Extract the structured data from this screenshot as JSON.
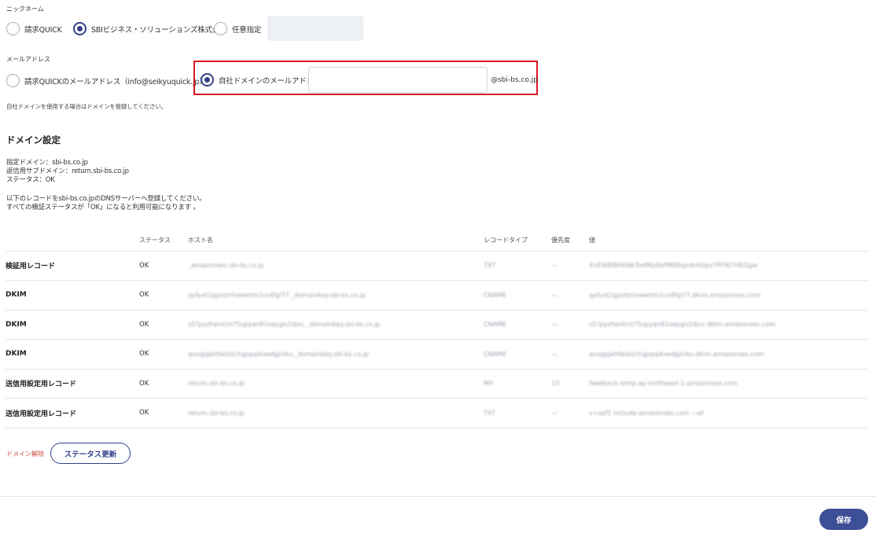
{
  "nickname": {
    "label": "ニックネーム",
    "options": [
      {
        "label": "請求QUICK",
        "checked": false
      },
      {
        "label": "SBIビジネス・ソリューションズ株式会社",
        "checked": true
      },
      {
        "label": "任意指定",
        "checked": false
      }
    ],
    "custom_value": ""
  },
  "email": {
    "label": "メールアドレス",
    "option_default": "請求QUICKのメールアドレス（info@seikyuquick.jp）",
    "option_custom": "自社ドメインのメールアドレス",
    "local_part_value": "",
    "domain_suffix": "@sbi-bs.co.jp",
    "note": "自社ドメインを使用する場合はドメインを登録してください。"
  },
  "domain": {
    "heading": "ドメイン設定",
    "info": [
      "指定ドメイン：sbi-bs.co.jp",
      "返信用サブドメイン：return.sbi-bs.co.jp",
      "ステータス：OK"
    ],
    "instructions": [
      "以下のレコードをsbi-bs.co.jpのDNSサーバーへ登録してください。",
      "すべての検証ステータスが「OK」になると利用可能になります 。"
    ]
  },
  "table": {
    "headers": [
      "",
      "ステータス",
      "ホスト名",
      "レコードタイプ",
      "優先度",
      "値"
    ],
    "rows": [
      {
        "name": "検証用レコード",
        "status": "OK",
        "host": "_amazonses.sbi-bs.co.jp",
        "type": "TXT",
        "priority": "—",
        "value": "XnEW8lBHhNbTrefMy6bPM0Rgsdrrk0pvTPF9LTHEGgw"
      },
      {
        "name": "DKIM",
        "status": "OK",
        "host": "qyfyxt2gpotzrlnewmts1cs4fgl77._domainkey.sbi-bs.co.jp",
        "type": "CNAME",
        "priority": "—",
        "value": "qyfyxt2gpotzrlnewmts1cs4fgl77.dkim.amazonses.com"
      },
      {
        "name": "DKIM",
        "status": "OK",
        "host": "s5?pyzhenlcm?5upyan82oaygn2djvc._domainkey.sbi-bs.co.jp",
        "type": "CNAME",
        "priority": "—",
        "value": "s5?pyzhenlcm?5upyan82oaygn2djvc.dkim.amazonses.com"
      },
      {
        "name": "DKIM",
        "status": "OK",
        "host": "quogjgehfadzzchgjqopkxedgzvku._domainkey.sbi-bs.co.jp",
        "type": "CNAME",
        "priority": "—",
        "value": "quogjgehfadzzchgjqopkxedgzvku.dkim.amazonses.com"
      },
      {
        "name": "送信用設定用レコード",
        "status": "OK",
        "host": "return.sbi-bs.co.jp",
        "type": "MX",
        "priority": "10",
        "value": "feedback-smtp.ap-northeast-1.amazonses.com"
      },
      {
        "name": "送信用設定用レコード",
        "status": "OK",
        "host": "return.sbi-bs.co.jp",
        "type": "TXT",
        "priority": "—",
        "value": "v=spf1 include:amazonses.com ~all"
      }
    ]
  },
  "actions": {
    "remove_domain": "ドメイン解除",
    "update_status": "ステータス更新",
    "save": "保存"
  },
  "colors": {
    "accent": "#34428a",
    "highlight_border": "#d7191f",
    "danger_link": "#c94a3e"
  }
}
